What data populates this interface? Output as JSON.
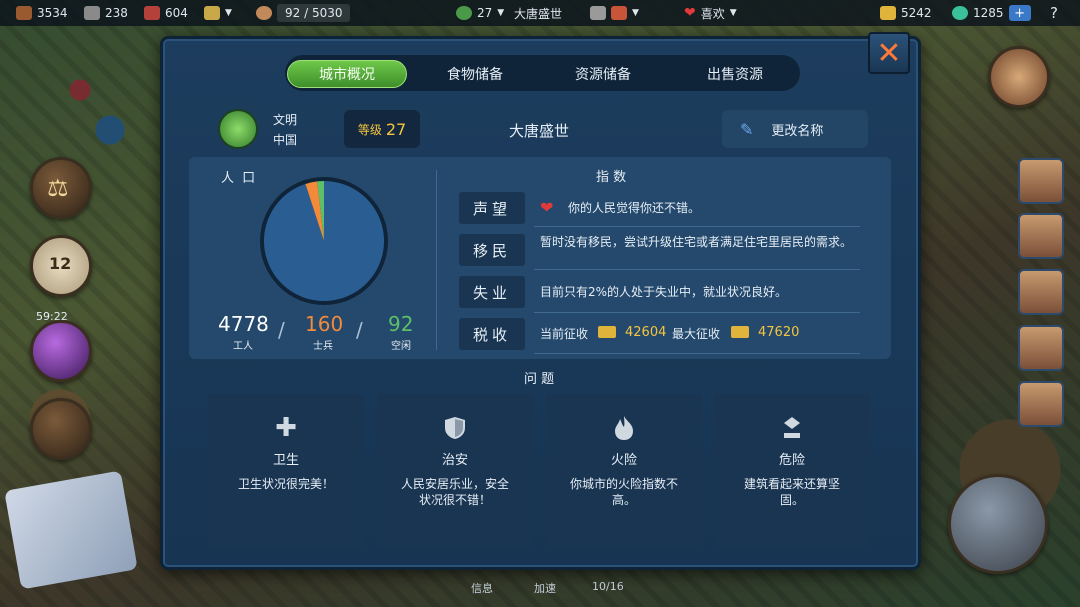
{
  "topbar": {
    "wood": "3534",
    "tools": "238",
    "ore": "604",
    "population": "92 / 5030",
    "culture_count": "27",
    "empire_name": "大唐盛世",
    "mood": "喜欢",
    "gold": "5242",
    "gems": "1285",
    "plus": "+",
    "help": "?"
  },
  "tabs": [
    "城市概况",
    "食物储备",
    "资源储备",
    "出售资源"
  ],
  "header": {
    "civ_label": "文明",
    "civ_name": "中国",
    "level_label": "等级",
    "level_value": "27",
    "city_name": "大唐盛世",
    "rename_label": "更改名称"
  },
  "population": {
    "label": "人 口",
    "workers": "4778",
    "workers_label": "工人",
    "soldiers": "160",
    "soldiers_label": "士兵",
    "idle": "92",
    "idle_label": "空闲",
    "sep": "/"
  },
  "chart_data": {
    "type": "pie",
    "categories": [
      "工人",
      "士兵",
      "空闲"
    ],
    "values": [
      4778,
      160,
      92
    ],
    "colors": [
      "#2a5e93",
      "#f28a3a",
      "#5cbf6a"
    ]
  },
  "indices": {
    "title": "指 数",
    "rows": [
      {
        "label": "声望",
        "text": "你的人民觉得你还不错。"
      },
      {
        "label": "移民",
        "text": "暂时没有移民，尝试升级住宅或者满足住宅里居民的需求。"
      },
      {
        "label": "失业",
        "text": "目前只有2%的人处于失业中，就业状况良好。"
      },
      {
        "label": "税收",
        "text": "当前征收"
      }
    ],
    "tax_current": "42604",
    "tax_max_label": "最大征收",
    "tax_max": "47620"
  },
  "problems": {
    "title": "问 题",
    "items": [
      {
        "title": "卫生",
        "desc": "卫生状况很完美！",
        "icon": "health-cross-icon"
      },
      {
        "title": "治安",
        "desc": "人民安居乐业，安全状况很不错！",
        "icon": "shield-icon"
      },
      {
        "title": "火险",
        "desc": "你城市的火险指数不高。",
        "icon": "fire-icon"
      },
      {
        "title": "危险",
        "desc": "建筑看起来还算坚固。",
        "icon": "collapse-warning-icon"
      }
    ]
  },
  "side": {
    "timer": "59:22",
    "calendar": "12"
  },
  "bottom": {
    "info": "信息",
    "speed": "加速",
    "count": "10/16"
  },
  "colors": {
    "accent_green": "#6fc84a",
    "gold": "#f5c542",
    "soldier": "#f28a3a",
    "idle": "#5cbf6a",
    "panel": "#24496c"
  }
}
